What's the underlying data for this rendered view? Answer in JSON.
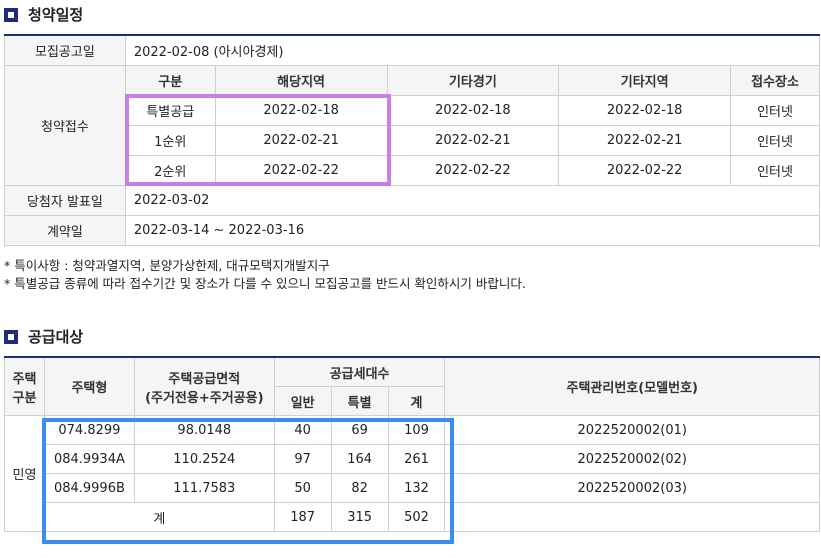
{
  "schedule": {
    "title": "청약일정",
    "notice_label": "모집공고일",
    "notice_value": "2022-02-08 (아시아경제)",
    "apply_label": "청약접수",
    "headers": [
      "구분",
      "해당지역",
      "기타경기",
      "기타지역",
      "접수장소"
    ],
    "rows": [
      [
        "특별공급",
        "2022-02-18",
        "2022-02-18",
        "2022-02-18",
        "인터넷"
      ],
      [
        "1순위",
        "2022-02-21",
        "2022-02-21",
        "2022-02-21",
        "인터넷"
      ],
      [
        "2순위",
        "2022-02-22",
        "2022-02-22",
        "2022-02-22",
        "인터넷"
      ]
    ],
    "winner_label": "당첨자 발표일",
    "winner_value": "2022-03-02",
    "contract_label": "계약일",
    "contract_value": "2022-03-14 ~ 2022-03-16"
  },
  "notes": [
    "* 특이사항 : 청약과열지역, 분양가상한제, 대규모택지개발지구",
    "* 특별공급 종류에 따라 접수기간 및 장소가 다를 수 있으니 모집공고를 반드시 확인하시기 바랍니다."
  ],
  "supply": {
    "title": "공급대상",
    "h_type_line1": "주택",
    "h_type_line2": "구분",
    "h_model": "주택형",
    "h_area_line1": "주택공급면적",
    "h_area_line2": "(주거전용+주거공용)",
    "h_units": "공급세대수",
    "h_general": "일반",
    "h_special": "특별",
    "h_sum": "계",
    "h_mgmt": "주택관리번호(모델번호)",
    "category": "민영",
    "rows": [
      [
        "074.8299",
        "98.0148",
        "40",
        "69",
        "109",
        "2022520002(01)"
      ],
      [
        "084.9934A",
        "110.2524",
        "97",
        "164",
        "261",
        "2022520002(02)"
      ],
      [
        "084.9996B",
        "111.7583",
        "50",
        "82",
        "132",
        "2022520002(03)"
      ]
    ],
    "total_label": "계",
    "total_general": "187",
    "total_special": "315",
    "total_sum": "502"
  }
}
